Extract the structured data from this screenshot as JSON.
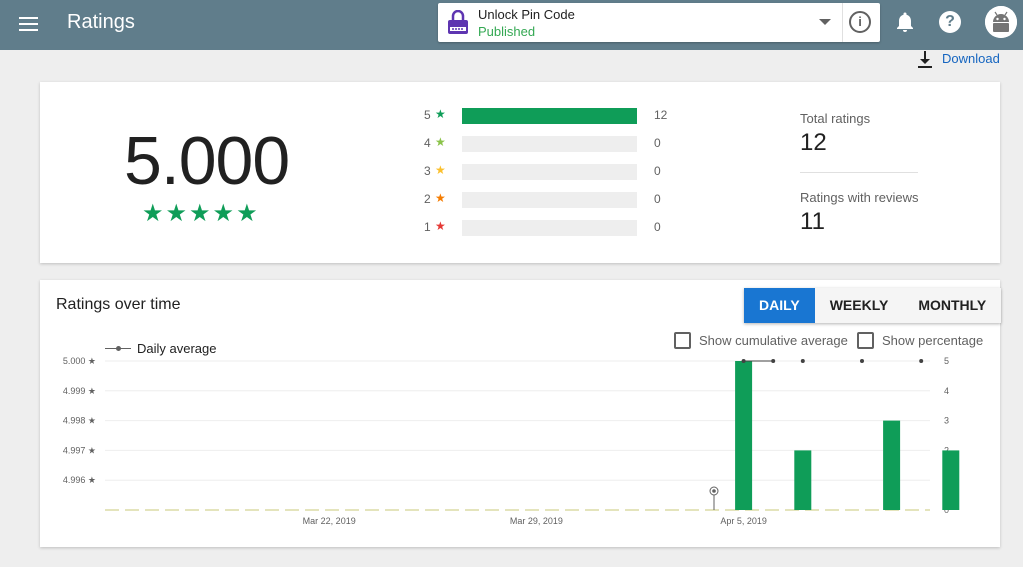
{
  "header": {
    "page_title": "Ratings",
    "app_name": "Unlock Pin Code",
    "app_status": "Published",
    "info_symbol": "i",
    "help_symbol": "?",
    "icons": [
      "menu-icon",
      "app-lock-icon",
      "chevron-down-icon",
      "info-icon",
      "bell-icon",
      "help-icon",
      "avatar-android-icon"
    ]
  },
  "download": {
    "label": "Download",
    "icon": "download-icon"
  },
  "summary": {
    "average": "5.000",
    "stars": "★★★★★",
    "distribution": [
      {
        "stars": "5",
        "count": "12",
        "fraction": 1.0,
        "star_color": "#0f9d58"
      },
      {
        "stars": "4",
        "count": "0",
        "fraction": 0,
        "star_color": "#8bc34a"
      },
      {
        "stars": "3",
        "count": "0",
        "fraction": 0,
        "star_color": "#fbc02d"
      },
      {
        "stars": "2",
        "count": "0",
        "fraction": 0,
        "star_color": "#f57c00"
      },
      {
        "stars": "1",
        "count": "0",
        "fraction": 0,
        "star_color": "#e53935"
      }
    ],
    "total_ratings_label": "Total ratings",
    "total_ratings_value": "12",
    "reviews_label": "Ratings with reviews",
    "reviews_value": "11"
  },
  "over_time": {
    "title": "Ratings over time",
    "tabs": [
      {
        "label": "DAILY",
        "active": true
      },
      {
        "label": "WEEKLY",
        "active": false
      },
      {
        "label": "MONTHLY",
        "active": false
      }
    ],
    "show_cumulative_label": "Show cumulative average",
    "show_percentage_label": "Show percentage",
    "legend_label": "Daily average"
  },
  "colors": {
    "topbar": "#607d8b",
    "accent": "#1976d2",
    "bar": "#0f9d58",
    "published": "#34a853"
  },
  "chart_data": {
    "type": "bar",
    "x_ticks": [
      "Mar 22, 2019",
      "Mar 29, 2019",
      "Apr 5, 2019"
    ],
    "x_tick_days": [
      7,
      14,
      21
    ],
    "y_left_ticks": [
      "5.000 ★",
      "4.999 ★",
      "4.998 ★",
      "4.997 ★",
      "4.996 ★"
    ],
    "y_right_ticks": [
      "5",
      "4",
      "3",
      "2",
      "1",
      "0"
    ],
    "y_right_range": [
      0,
      5
    ],
    "series": [
      {
        "name": "Daily ratings",
        "type": "bar",
        "x_days": [
          21,
          23,
          26,
          28
        ],
        "values": [
          5,
          2,
          3,
          2
        ]
      },
      {
        "name": "Daily average",
        "type": "line-points",
        "x_days": [
          21,
          22,
          23,
          25,
          27
        ],
        "values": [
          5.0,
          5.0,
          5.0,
          5.0,
          5.0
        ]
      }
    ],
    "grid": true
  }
}
